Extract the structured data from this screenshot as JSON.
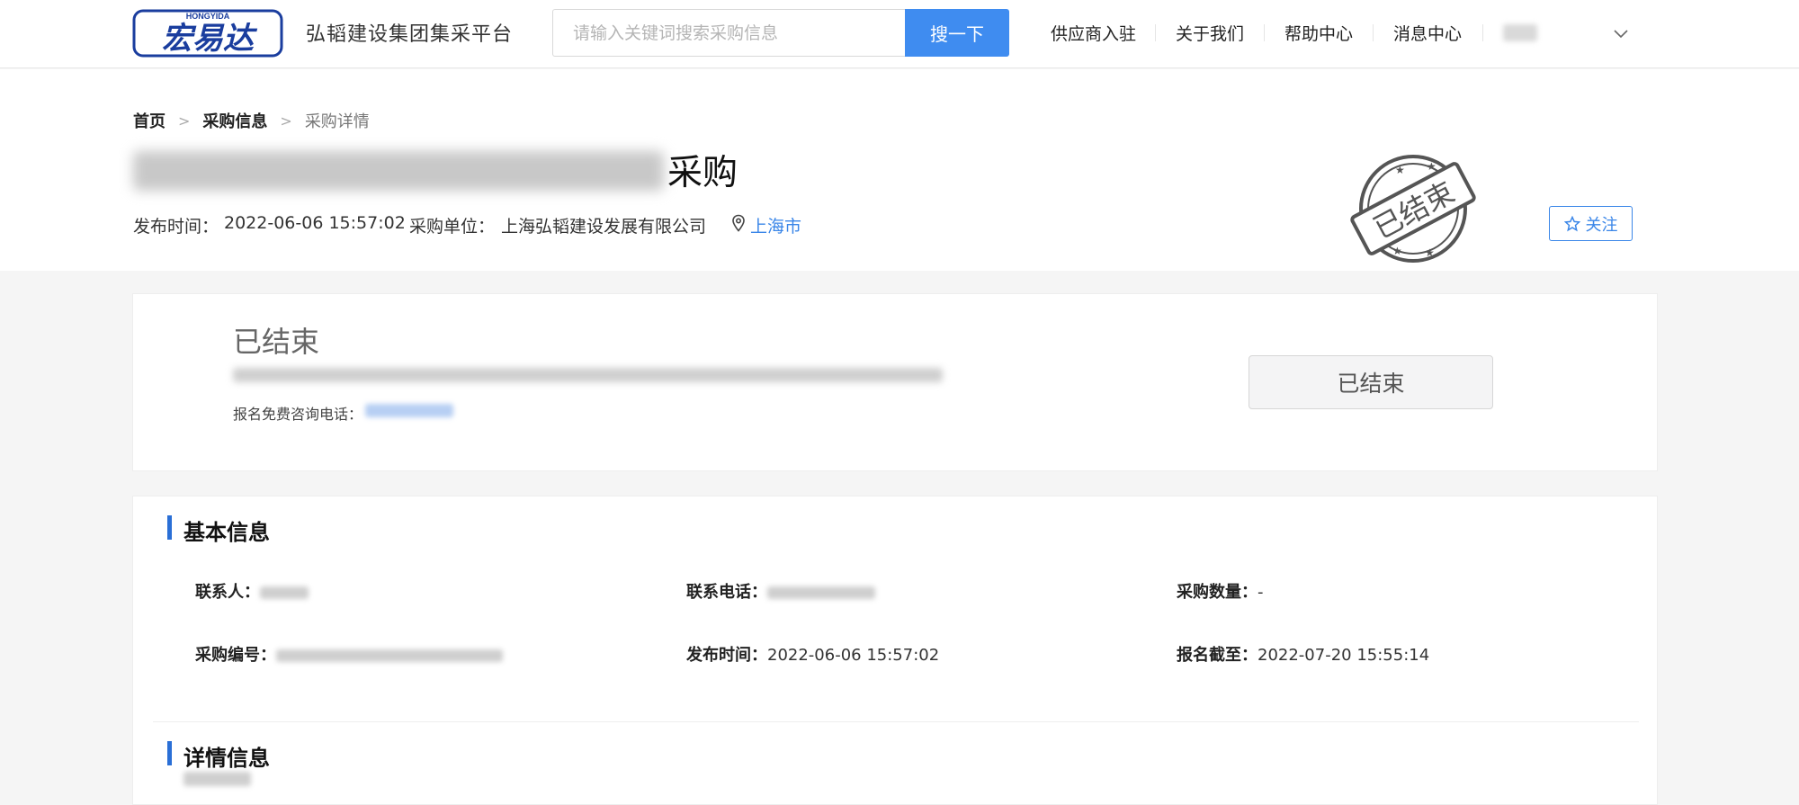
{
  "header": {
    "logo_word": "宏易达",
    "logo_sub": "HONGYIDA",
    "platform_name": "弘韬建设集团集采平台",
    "search_placeholder": "请输入关键词搜索采购信息",
    "search_button": "搜一下",
    "nav": [
      "供应商入驻",
      "关于我们",
      "帮助中心",
      "消息中心"
    ]
  },
  "breadcrumb": {
    "home": "首页",
    "section": "采购信息",
    "current": "采购详情"
  },
  "title": {
    "suffix": "采购",
    "stamp_text": "已结束"
  },
  "meta": {
    "publish_label": "发布时间：",
    "publish_time": "2022-06-06 15:57:02",
    "unit_label": "采购单位：",
    "unit": "上海弘韬建设发展有限公司",
    "city": "上海市"
  },
  "follow_button": "关注",
  "status": {
    "title": "已结束",
    "phone_label": "报名免费咨询电话：",
    "button": "已结束"
  },
  "basic_info": {
    "title": "基本信息",
    "contact_label": "联系人：",
    "phone_label": "联系电话：",
    "quantity_label": "采购数量：",
    "quantity": "-",
    "code_label": "采购编号：",
    "publish_label": "发布时间：",
    "publish_time": "2022-06-06 15:57:02",
    "deadline_label": "报名截至：",
    "deadline": "2022-07-20 15:55:14"
  },
  "detail_info": {
    "title": "详情信息"
  },
  "colors": {
    "primary": "#3f8cf0",
    "link": "#3a86e8",
    "section_bar": "#2a6fd6",
    "logo_blue": "#1a3d9e"
  }
}
